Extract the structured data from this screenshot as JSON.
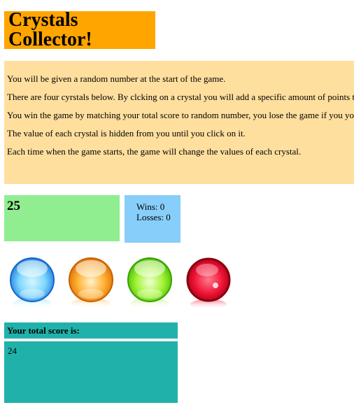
{
  "title": "Crystals Collector!",
  "instructions": [
    "You will be given a random number at the start of the game.",
    "There are four cyrstals below. By clcking on a crystal you will add a specific amount of points to your total score.",
    "You win the game by matching your total score to random number, you lose the game if you your total score goes above the random number.",
    "The value of each crystal is hidden from you until you click on it.",
    "Each time when the game starts, the game will change the values of each crystal."
  ],
  "target_number": "25",
  "stats": {
    "wins_text": "Wins: 0",
    "losses_text": "Losses: 0"
  },
  "crystals": [
    {
      "name": "blue-crystal",
      "color": "#3ea6f5"
    },
    {
      "name": "orange-crystal",
      "color": "#f78a0a"
    },
    {
      "name": "green-crystal",
      "color": "#7ee01c"
    },
    {
      "name": "red-crystal",
      "color": "#d5001b"
    }
  ],
  "score": {
    "header": "Your total score is:",
    "value": "24"
  }
}
